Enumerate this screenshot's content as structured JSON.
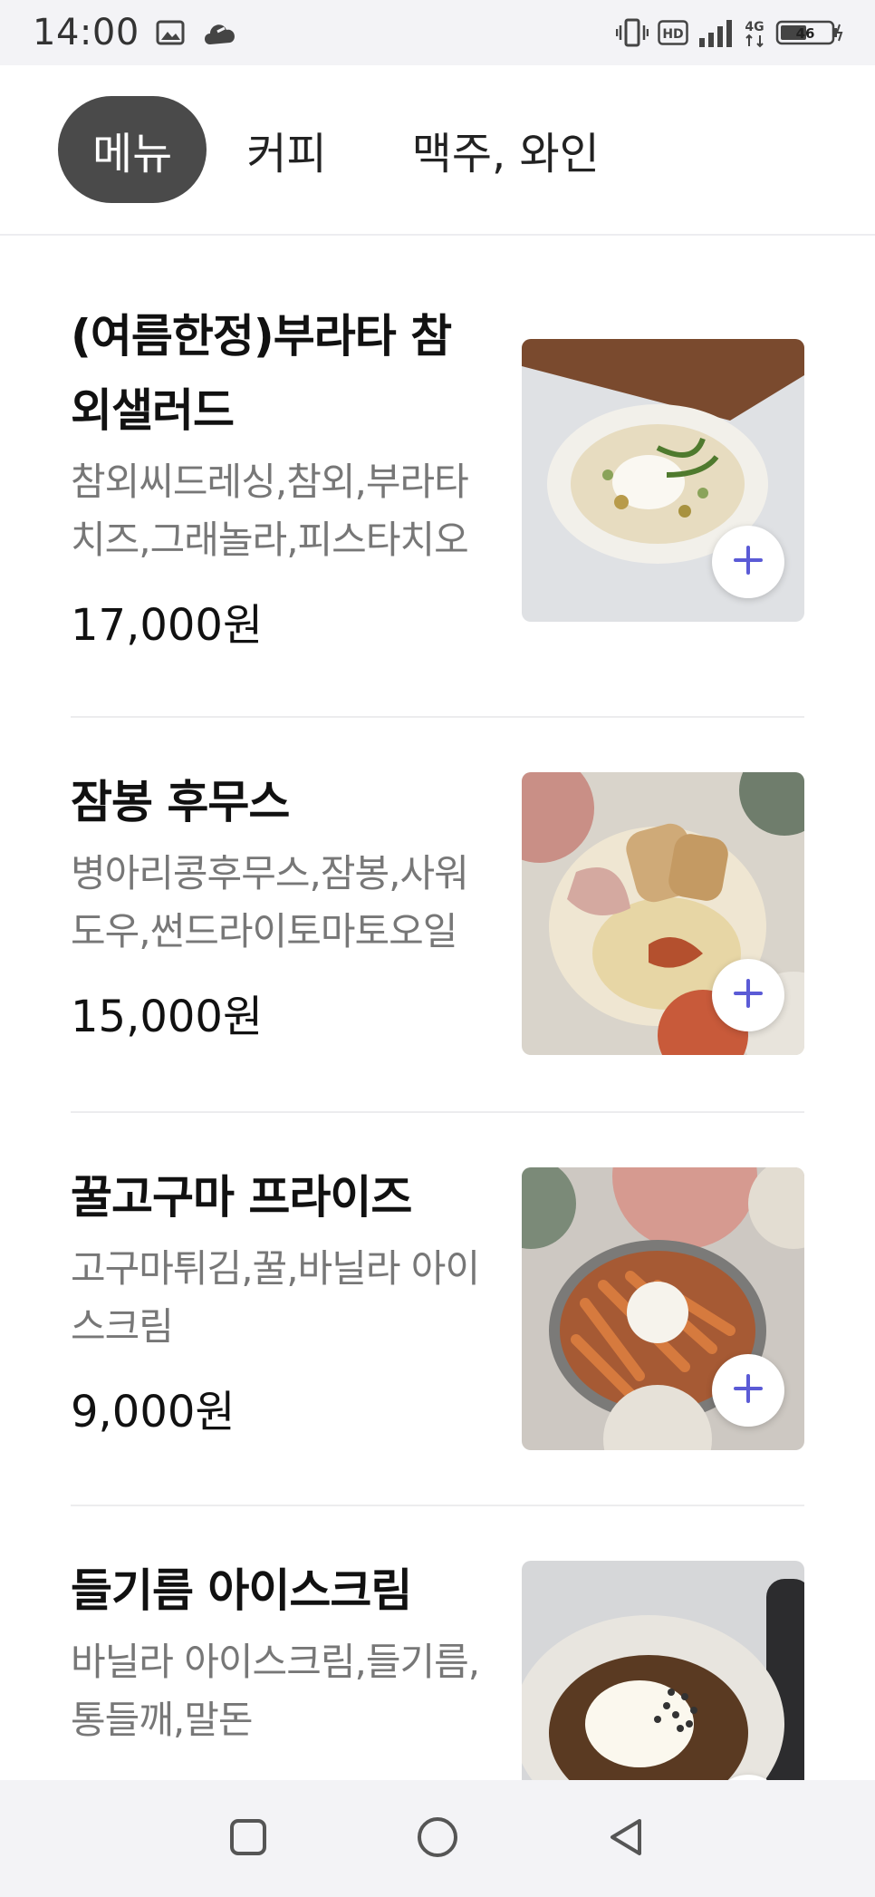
{
  "status_bar": {
    "time": "14:00",
    "network": "4G",
    "battery": "46",
    "hd": "HD",
    "icons": [
      "image-icon",
      "cloud-icon",
      "vibrate-icon",
      "hd-icon",
      "signal-icon",
      "network-4g-icon",
      "battery-icon"
    ]
  },
  "tabs": [
    {
      "label": "메뉴",
      "active": true
    },
    {
      "label": "커피",
      "active": false
    },
    {
      "label": "맥주, 와인",
      "active": false
    }
  ],
  "menu_items": [
    {
      "name": "(여름한정)부라타 참외샐러드",
      "description": "참외씨드레싱,참외,부라타치즈,그래놀라,피스타치오",
      "price": "17,000원",
      "image_icon": "burrata-salad-photo"
    },
    {
      "name": "잠봉 후무스",
      "description": "병아리콩후무스,잠봉,사워도우,썬드라이토마토오일",
      "price": "15,000원",
      "image_icon": "jambon-hummus-photo"
    },
    {
      "name": "꿀고구마 프라이즈",
      "description": "고구마튀김,꿀,바닐라 아이스크림",
      "price": "9,000원",
      "image_icon": "sweet-potato-fries-photo"
    },
    {
      "name": "들기름 아이스크림",
      "description": "바닐라 아이스크림,들기름,통들깨,말돈",
      "price": "",
      "image_icon": "perilla-oil-ice-cream-photo"
    }
  ],
  "colors": {
    "active_tab_bg": "#4a4a4a",
    "add_icon": "#5b5bd6",
    "description_text": "#777777",
    "system_bar_bg": "#f3f3f6"
  },
  "nav_bar": {
    "icons": [
      "recent-apps-icon",
      "home-icon",
      "back-icon"
    ]
  }
}
